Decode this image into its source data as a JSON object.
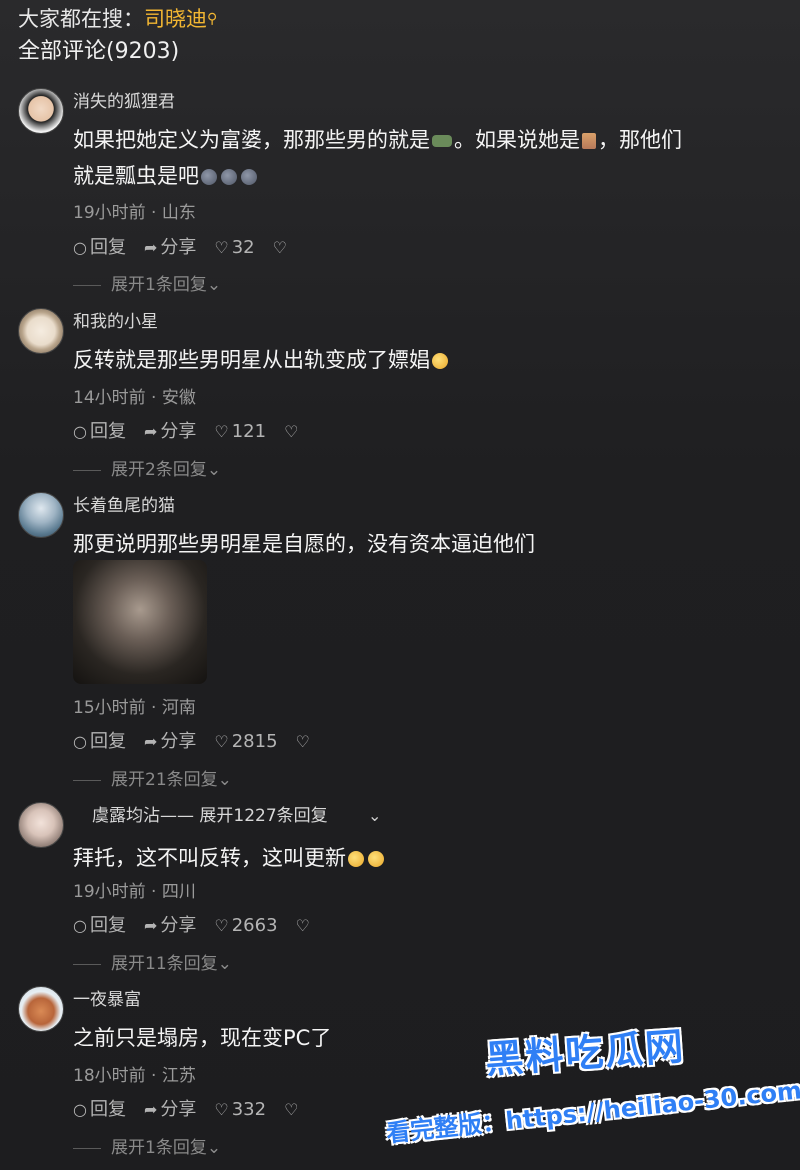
{
  "header": {
    "search_prefix": "大家都在搜：",
    "search_keyword": "司晓迪",
    "total_label": "全部评论(9203)"
  },
  "actions": {
    "reply": "回复",
    "share": "分享"
  },
  "comments": [
    {
      "username": "消失的狐狸君",
      "text_part1": "如果把她定义为富婆，那那些男的就是",
      "text_part2": "。如果说她是",
      "text_part3": "，那他们",
      "text_line2": "就是瓢虫是吧",
      "meta": "19小时前 · 山东",
      "likes": "32",
      "expand": "展开1条回复"
    },
    {
      "username": "和我的小星",
      "text": "反转就是那些男明星从出轨变成了嫖娼",
      "meta": "14小时前 · 安徽",
      "likes": "121",
      "expand": "展开2条回复"
    },
    {
      "username": "长着鱼尾的猫",
      "text": "那更说明那些男明星是自愿的，没有资本逼迫他们",
      "meta": "15小时前 · 河南",
      "likes": "2815",
      "expand": "展开21条回复"
    },
    {
      "username": "虞露均沾—— 展开1227条回复",
      "text": "拜托，这不叫反转，这叫更新",
      "meta": "19小时前 · 四川",
      "likes": "2663",
      "expand": "展开11条回复"
    },
    {
      "username": "一夜暴富",
      "text": "之前只是塌房，现在变PC了",
      "meta": "18小时前 · 江苏",
      "likes": "332",
      "expand": "展开1条回复"
    }
  ],
  "watermark": {
    "logo": "黑料吃瓜网",
    "text": "看完整版：https://heiliao-30.com"
  }
}
